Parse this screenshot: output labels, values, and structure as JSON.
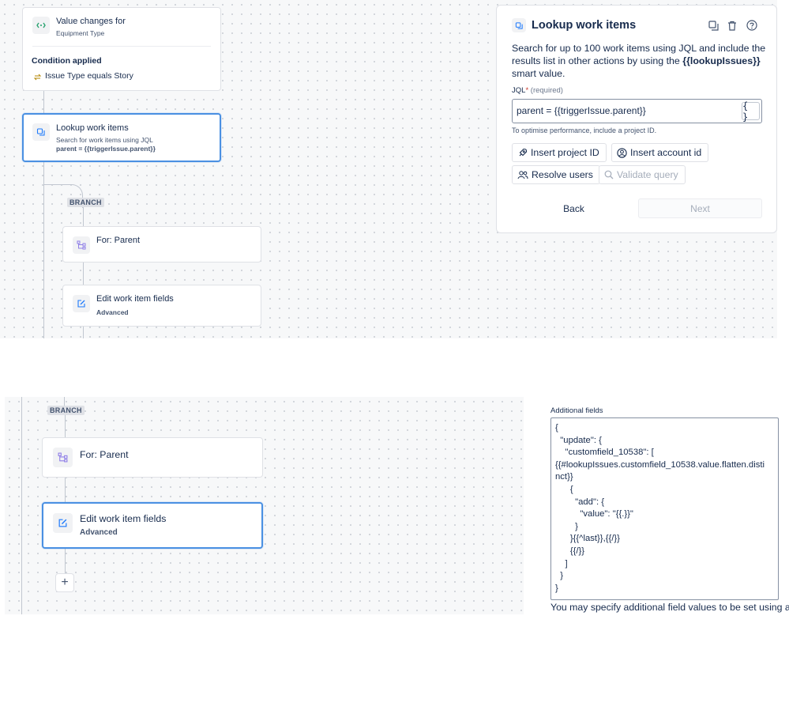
{
  "top_flow": {
    "trigger": {
      "title": "Value changes for",
      "subtitle": "Equipment Type",
      "condition_heading": "Condition applied",
      "condition_text": "Issue Type equals Story"
    },
    "lookup": {
      "title": "Lookup work items",
      "subtitle": "Search for work items using JQL",
      "query": "parent = {{triggerIssue.parent}}"
    },
    "branch_label": "BRANCH",
    "for_parent": {
      "title": "For: Parent"
    },
    "edit_fields": {
      "title": "Edit work item fields",
      "subtitle": "Advanced"
    }
  },
  "panel": {
    "title": "Lookup work items",
    "description_prefix": "Search for up to 100 work items using JQL and include the results list in other actions by using the ",
    "description_smart_value": "{{lookupIssues}}",
    "description_suffix": " smart value.",
    "jql_label": "JQL",
    "jql_required_mark": "*",
    "jql_required_text": "(required)",
    "jql_value": "parent = {{triggerIssue.parent}}",
    "brace_button": "{ }",
    "hint": "To optimise performance, include a project ID.",
    "buttons": {
      "insert_project_id": "Insert project ID",
      "insert_account_id": "Insert account id",
      "resolve_users": "Resolve users",
      "validate_query": "Validate query"
    },
    "back": "Back",
    "next": "Next"
  },
  "bottom_flow": {
    "branch_label": "BRANCH",
    "for_parent": {
      "title": "For: Parent"
    },
    "edit_fields": {
      "title": "Edit work item fields",
      "subtitle": "Advanced"
    },
    "plus": "+"
  },
  "additional_fields": {
    "label": "Additional fields",
    "code": "{\n  \"update\": {\n    \"customfield_10538\": [\n{{#lookupIssues.customfield_10538.value.flatten.disti\nnct}}\n      {\n        \"add\": {\n          \"value\": \"{{.}}\"\n        }\n      }{{^last}},{{/}}\n      {{/}}\n    ]\n  }\n}",
    "help": "You may specify additional field values to be set using a"
  },
  "colors": {
    "selected_border": "#4a90e2",
    "trigger_icon": "#22a06b",
    "lookup_icon": "#1d7afc",
    "branch_icon": "#8f7ee7",
    "edit_icon": "#1d7afc"
  }
}
